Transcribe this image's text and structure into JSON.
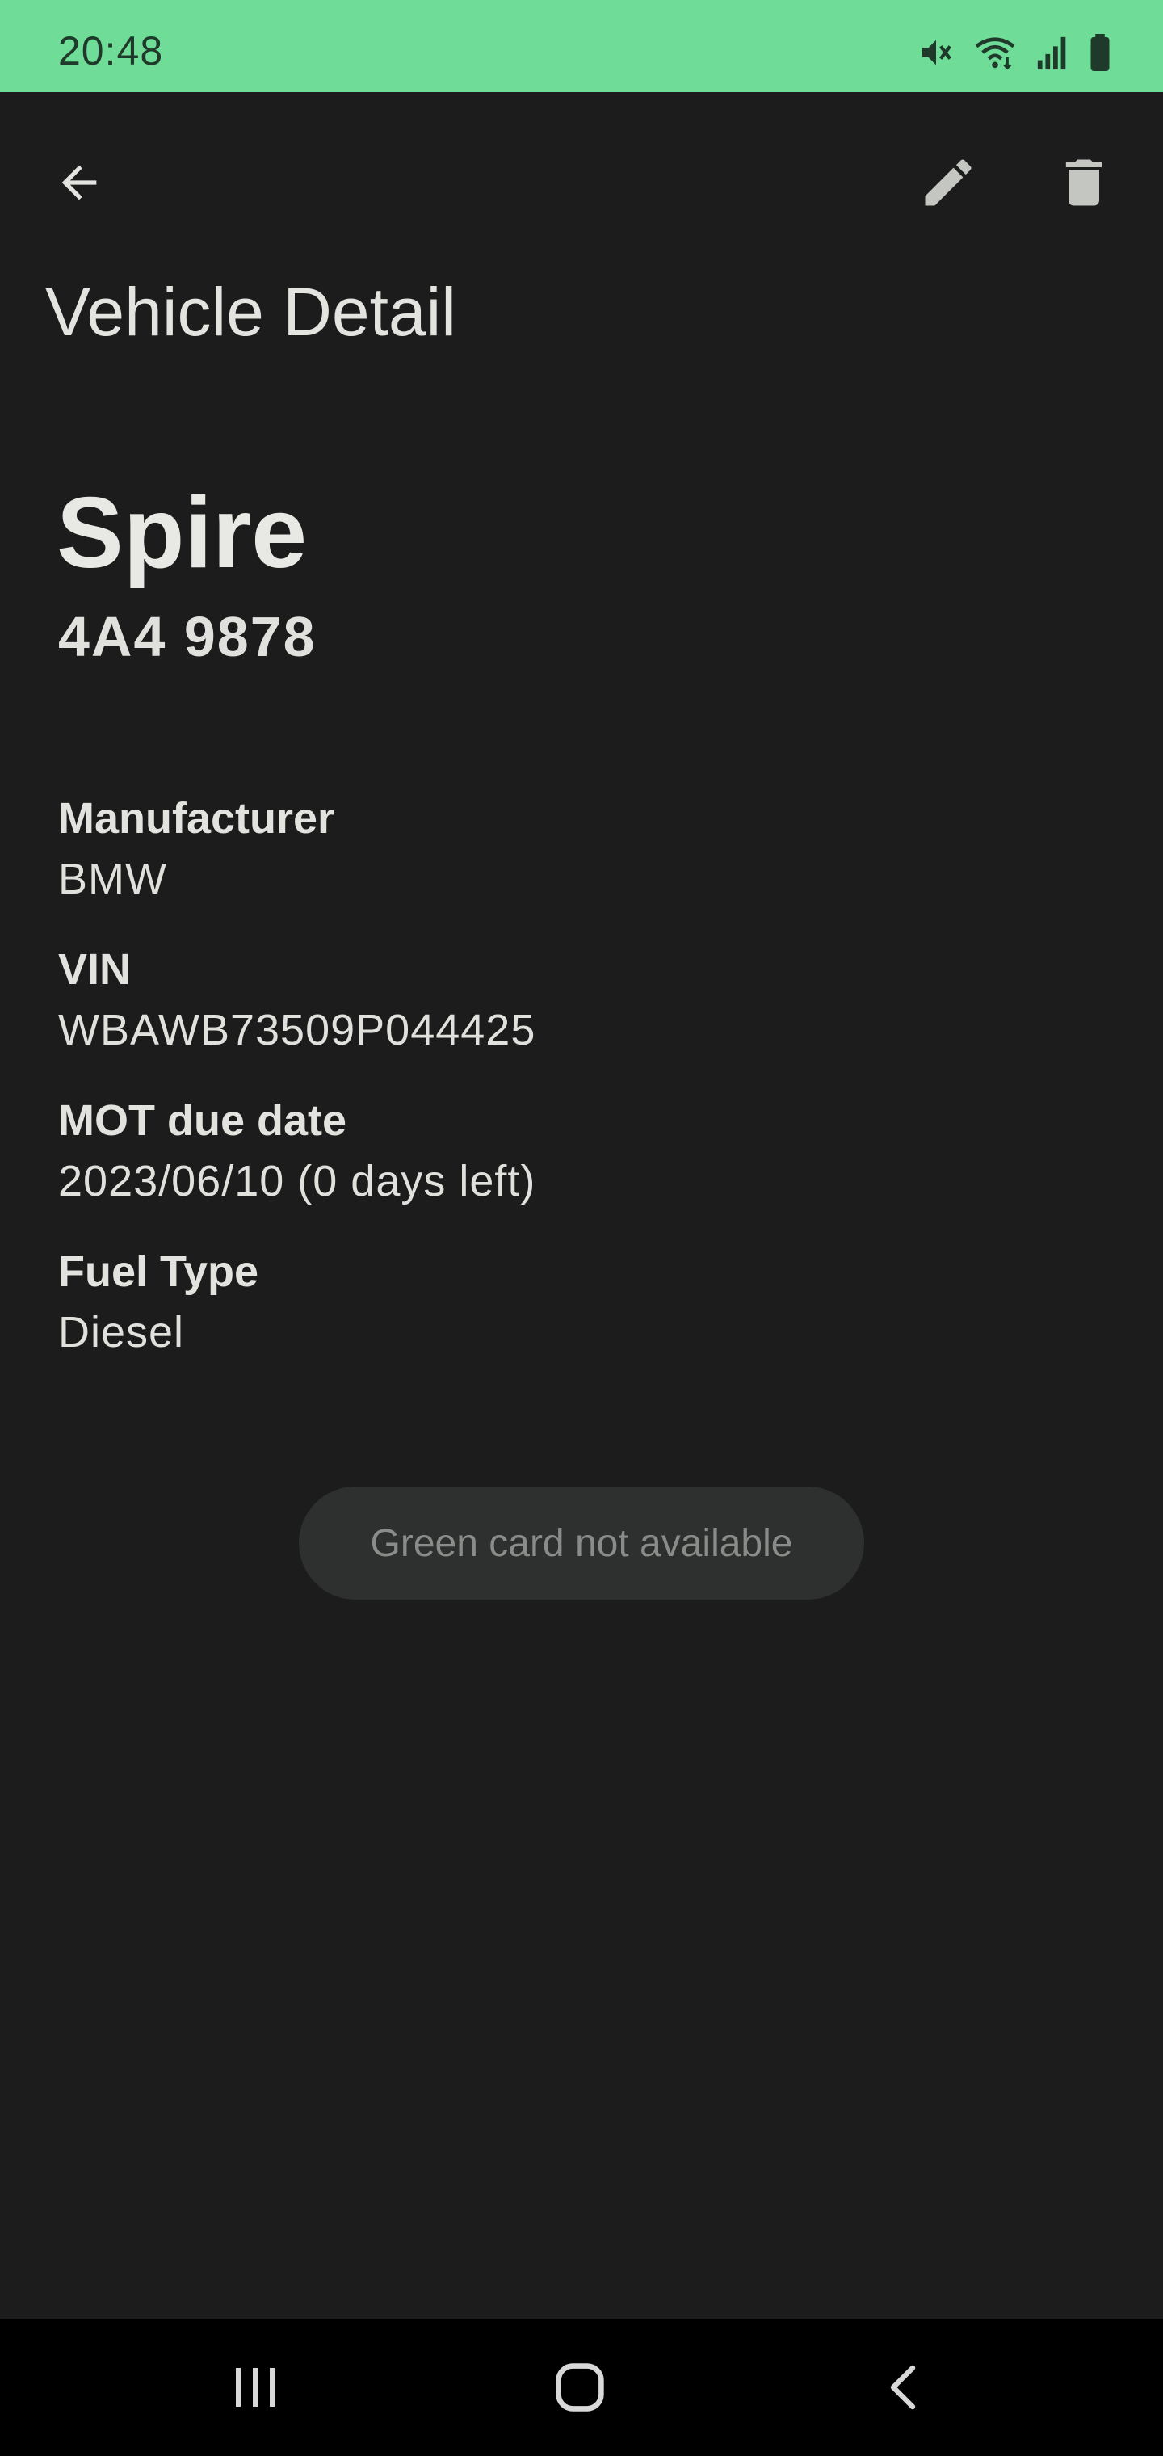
{
  "status_bar": {
    "time": "20:48",
    "icons": [
      "mute-icon",
      "wifi-icon",
      "signal-icon",
      "battery-icon"
    ],
    "background": "#6fdc98"
  },
  "app_bar": {
    "title": "Vehicle Detail",
    "icons": [
      "back-arrow-icon",
      "edit-pencil-icon",
      "delete-trash-icon"
    ]
  },
  "vehicle": {
    "name": "Spire",
    "plate": "4A4 9878"
  },
  "fields": [
    {
      "label": "Manufacturer",
      "value": "BMW"
    },
    {
      "label": "VIN",
      "value": "WBAWB73509P044425"
    },
    {
      "label": "MOT due date",
      "value": "2023/06/10 (0 days left)"
    },
    {
      "label": "Fuel Type",
      "value": "Diesel"
    }
  ],
  "green_card_button": {
    "label": "Green card not available",
    "enabled": false
  },
  "nav_bar": {
    "icons": [
      "recent-apps-icon",
      "home-icon",
      "back-nav-icon"
    ]
  },
  "colors": {
    "background": "#1b1c1b",
    "accent": "#6fdc98",
    "text": "#e2e2de",
    "icon": "#c4c6c2"
  }
}
